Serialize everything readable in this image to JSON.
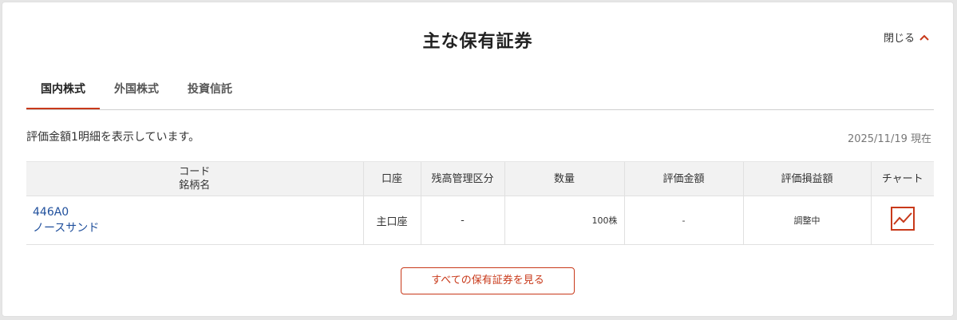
{
  "header": {
    "title": "主な保有証券",
    "close_label": "閉じる"
  },
  "tabs": [
    {
      "label": "国内株式",
      "active": true
    },
    {
      "label": "外国株式",
      "active": false
    },
    {
      "label": "投資信託",
      "active": false
    }
  ],
  "summary": {
    "note": "評価金額1明細を表示しています。",
    "as_of": "2025/11/19 現在"
  },
  "table": {
    "headers": {
      "code": "コード",
      "name": "銘柄名",
      "account": "口座",
      "balance_type": "残高管理区分",
      "quantity": "数量",
      "valuation": "評価金額",
      "pnl": "評価損益額",
      "chart": "チャート"
    },
    "rows": [
      {
        "code": "446A0",
        "name": "ノースサンド",
        "account": "主口座",
        "balance_type": "-",
        "quantity": "100株",
        "valuation": "-",
        "pnl": "調整中"
      }
    ]
  },
  "footer": {
    "view_all_label": "すべての保有証券を見る"
  },
  "colors": {
    "accent": "#c8391a",
    "link": "#1f4f9c",
    "header_bg": "#f2f2f2"
  }
}
